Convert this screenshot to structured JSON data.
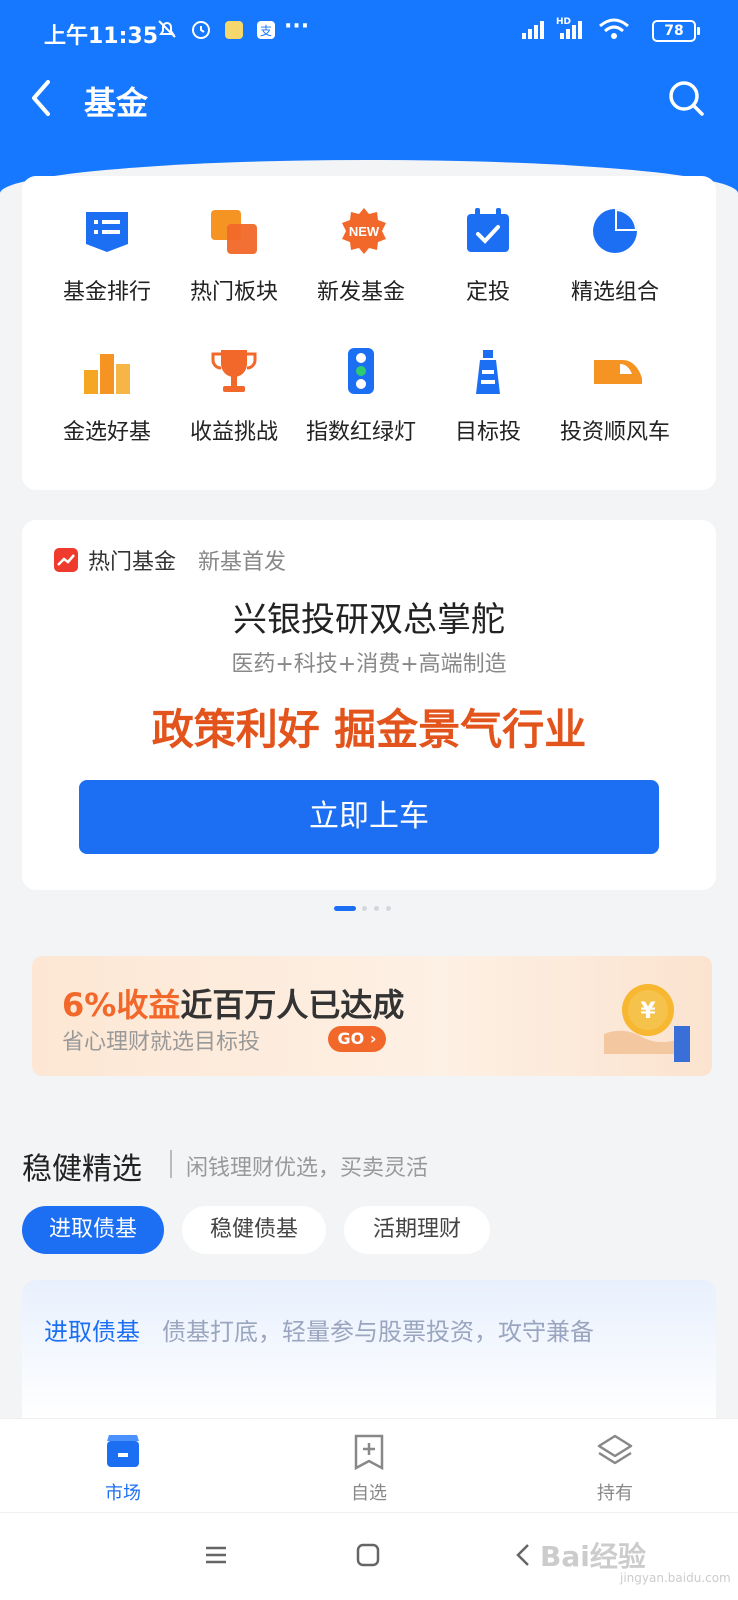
{
  "status_bar": {
    "time": "上午11:35",
    "battery": "78",
    "network": "HD"
  },
  "nav": {
    "title": "基金"
  },
  "quick_entries": [
    {
      "label": "基金排行",
      "icon": "list-icon",
      "color": "#1c6ff3"
    },
    {
      "label": "热门板块",
      "icon": "blocks-icon",
      "color": "#f59323"
    },
    {
      "label": "新发基金",
      "icon": "new-badge-icon",
      "color": "#f2682a"
    },
    {
      "label": "定投",
      "icon": "calendar-check-icon",
      "color": "#1c6ff3"
    },
    {
      "label": "精选组合",
      "icon": "pie-chart-icon",
      "color": "#1c6ff3"
    },
    {
      "label": "金选好基",
      "icon": "podium-icon",
      "color": "#f5a623"
    },
    {
      "label": "收益挑战",
      "icon": "trophy-icon",
      "color": "#f2682a"
    },
    {
      "label": "指数红绿灯",
      "icon": "traffic-light-icon",
      "color": "#1c6ff3"
    },
    {
      "label": "目标投",
      "icon": "lighthouse-icon",
      "color": "#1c6ff3"
    },
    {
      "label": "投资顺风车",
      "icon": "car-icon",
      "color": "#f59323"
    }
  ],
  "promo": {
    "tag_main": "热门基金",
    "tag_sub": "新基首发",
    "title": "兴银投研双总掌舵",
    "subtitle": "医药+科技+消费+高端制造",
    "slogan": "政策利好 掘金景气行业",
    "cta": "立即上车"
  },
  "carousel": {
    "pages": 4,
    "active": 0
  },
  "banner": {
    "highlight": "6%收益",
    "headline": "近百万人已达成",
    "sub": "省心理财就选目标投",
    "go": "GO",
    "coin_symbol": "¥"
  },
  "section": {
    "title": "稳健精选",
    "subtitle": "闲钱理财优选，买卖灵活",
    "chips": [
      "进取债基",
      "稳健债基",
      "活期理财"
    ],
    "active_chip": 0,
    "desc_label": "进取债基",
    "desc_text": "债基打底，轻量参与股票投资，攻守兼备"
  },
  "tabbar": [
    {
      "label": "市场",
      "icon": "shop-icon",
      "active": true
    },
    {
      "label": "自选",
      "icon": "add-favorite-icon",
      "active": false
    },
    {
      "label": "持有",
      "icon": "layers-icon",
      "active": false
    }
  ],
  "watermark": {
    "text": "Bai经验",
    "sub": "jingyan.baidu.com"
  },
  "colors": {
    "brand_blue": "#1677ff",
    "accent_orange": "#f2682a",
    "inactive_gray": "#888888"
  }
}
